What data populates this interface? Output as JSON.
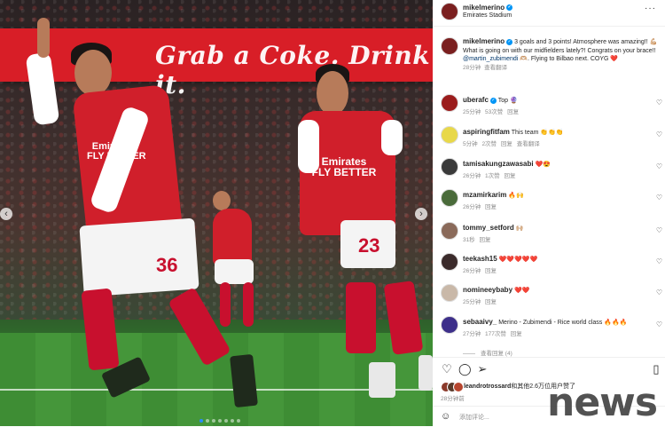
{
  "photo": {
    "banner_text": "Grab a Coke. Drink it.",
    "left_player": {
      "sponsor": "Emirates\nFLY BETTER",
      "number": "36"
    },
    "right_player": {
      "sponsor": "Emirates\nFLY BETTER",
      "number": "23"
    },
    "prev_arrow": "‹",
    "next_arrow": "›"
  },
  "post": {
    "username": "mikelmerino",
    "location": "Emirates Stadium",
    "more": "···",
    "caption": {
      "username": "mikelmerino",
      "line1": " 3 goals and 3 points! Atmosphere was amazing!! 💪🏼",
      "line2": "What is going on with our midfielders lately?! Congrats on your brace!! ",
      "mention": "@martin_zubimendi",
      "line3": " 🫶🏼. Flying to Bilbao next. COYG ❤️",
      "time": "28分钟",
      "translate": "查看翻译"
    },
    "comments": [
      {
        "user": "uberafc",
        "text": "Top 🔮",
        "time": "25分钟",
        "likes": "53次赞",
        "reply": "回复",
        "verified": true
      },
      {
        "user": "aspiringfitfam",
        "text": "This team 👏👏👏",
        "time": "5分钟",
        "likes": "2次赞",
        "reply": "回复",
        "extra": "查看翻译"
      },
      {
        "user": "tamisakungzawasabi",
        "text": "❤️😍",
        "time": "26分钟",
        "likes": "1次赞",
        "reply": "回复"
      },
      {
        "user": "mzamirkarim",
        "text": "🔥🙌",
        "time": "26分钟",
        "reply": "回复"
      },
      {
        "user": "tommy_setford",
        "text": "🙌🏼",
        "time": "31秒",
        "reply": "回复"
      },
      {
        "user": "teekash15",
        "text": "❤️❤️❤️❤️❤️",
        "time": "26分钟",
        "reply": "回复"
      },
      {
        "user": "nomineeybaby",
        "text": "❤️❤️",
        "time": "25分钟",
        "reply": "回复"
      },
      {
        "user": "sebaaivy_",
        "text": "Merino - Zubimendi - Rice world class 🔥🔥🔥",
        "time": "27分钟",
        "likes": "177次赞",
        "reply": "回复"
      }
    ],
    "view_replies": "查看回复 (4)",
    "likes_text_user": "leandrotrossard",
    "likes_text_rest": "和其他2.6万位用户赞了",
    "time_ago": "28分钟前",
    "comment_placeholder": "添加评论...",
    "watermark": "news"
  }
}
